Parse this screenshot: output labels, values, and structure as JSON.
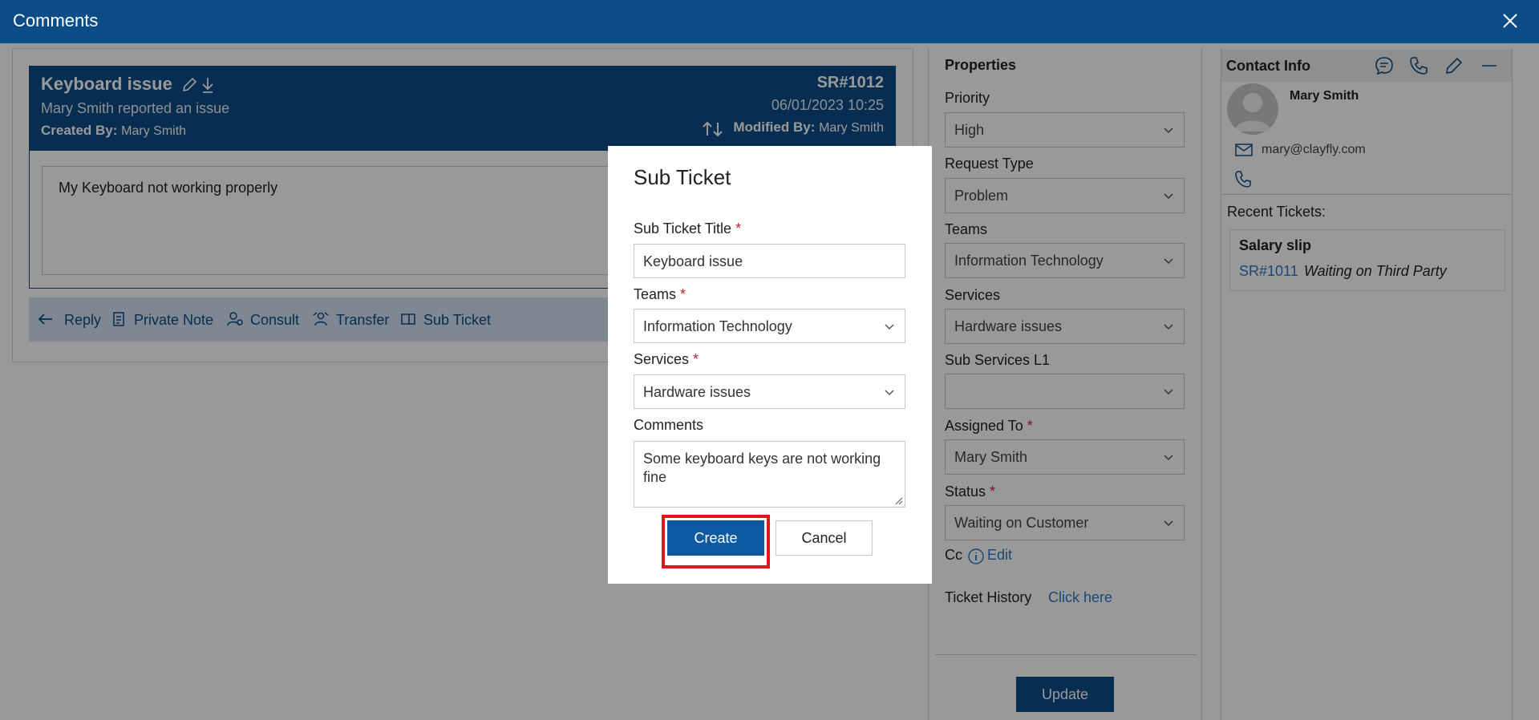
{
  "window": {
    "title": "Comments",
    "close_icon": "close-icon"
  },
  "ticket": {
    "title": "Keyboard issue",
    "subtitle": "Mary Smith reported an issue",
    "created_by_label": "Created By:",
    "created_by": "Mary Smith",
    "sr_number": "SR#1012",
    "datetime": "06/01/2023 10:25",
    "modified_by_label": "Modified By:",
    "modified_by": "Mary Smith",
    "comment": "My Keyboard not working properly"
  },
  "actions": {
    "reply": "Reply",
    "private_note": "Private Note",
    "consult": "Consult",
    "transfer": "Transfer",
    "sub_ticket": "Sub Ticket"
  },
  "properties": {
    "heading": "Properties",
    "priority": {
      "label": "Priority",
      "value": "High"
    },
    "request_type": {
      "label": "Request Type",
      "value": "Problem"
    },
    "teams": {
      "label": "Teams",
      "value": "Information Technology"
    },
    "services": {
      "label": "Services",
      "value": "Hardware issues"
    },
    "sub_services": {
      "label": "Sub Services L1",
      "value": ""
    },
    "assigned_to": {
      "label": "Assigned To",
      "value": "Mary Smith"
    },
    "status": {
      "label": "Status",
      "value": "Waiting on Customer"
    },
    "required_mark": "*",
    "cc_label": "Cc",
    "cc_edit": "Edit",
    "history_label": "Ticket History",
    "history_link": "Click here",
    "update_button": "Update"
  },
  "contact": {
    "heading": "Contact Info",
    "name": "Mary Smith",
    "email": "mary@clayfly.com",
    "recent_label": "Recent Tickets:",
    "recent_tickets": [
      {
        "title": "Salary slip",
        "sr": "SR#1011",
        "status": "Waiting on Third Party"
      }
    ]
  },
  "modal": {
    "title": "Sub Ticket",
    "title_field": {
      "label": "Sub Ticket Title",
      "value": "Keyboard issue"
    },
    "teams_field": {
      "label": "Teams",
      "value": "Information Technology"
    },
    "services_field": {
      "label": "Services",
      "value": "Hardware issues"
    },
    "comments_field": {
      "label": "Comments",
      "value": "Some keyboard keys are not working fine"
    },
    "required_mark": "*",
    "create_button": "Create",
    "cancel_button": "Cancel"
  },
  "colors": {
    "brand": "#0d4d87",
    "link": "#2b78c5",
    "required": "#c4262e",
    "highlight": "#e5141b"
  }
}
